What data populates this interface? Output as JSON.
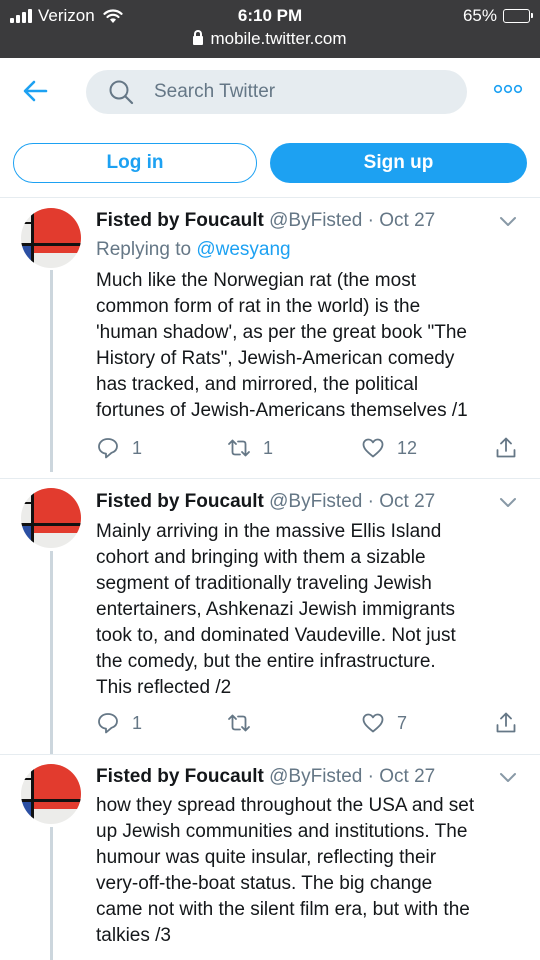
{
  "status_bar": {
    "carrier": "Verizon",
    "time": "6:10 PM",
    "url": "mobile.twitter.com",
    "battery": "65%",
    "battery_level": 0.65,
    "accent": "#ffd60a"
  },
  "header": {
    "back_icon": "back-arrow-icon",
    "search_placeholder": "Search Twitter",
    "more_icon": "more-dots-icon"
  },
  "auth": {
    "login_label": "Log in",
    "signup_label": "Sign up"
  },
  "colors": {
    "brand": "#1da1f2",
    "muted": "#657786"
  },
  "tweets": [
    {
      "name": "Fisted by Foucault",
      "handle": "@ByFisted",
      "date": "· Oct 27",
      "reply_prefix": "Replying to",
      "reply_to": "@wesyang",
      "lines": [
        "Much like the Norwegian rat (the most",
        "common form of rat in the world) is the",
        "'human shadow', as per the great book \"The",
        "History of Rats\", Jewish-American comedy",
        "has tracked, and mirrored, the political",
        "fortunes of Jewish-Americans themselves /1"
      ],
      "replies": "1",
      "retweets": "1",
      "likes": "12"
    },
    {
      "name": "Fisted by Foucault",
      "handle": "@ByFisted",
      "date": "· Oct 27",
      "lines": [
        "Mainly arriving in the massive Ellis Island",
        "cohort and bringing with them a sizable",
        "segment of traditionally traveling Jewish",
        "entertainers, Ashkenazi Jewish immigrants",
        "took to, and dominated Vaudeville.  Not just",
        "the comedy, but the entire infrastructure.",
        "This reflected /2"
      ],
      "replies": "1",
      "retweets": "",
      "likes": "7"
    },
    {
      "name": "Fisted by Foucault",
      "handle": "@ByFisted",
      "date": "· Oct 27",
      "lines": [
        "how they spread throughout the USA and set",
        "up Jewish communities and institutions.  The",
        "humour was quite insular, reflecting their",
        "very-off-the-boat status.  The big change",
        "came not with the silent film era, but with the",
        "talkies /3"
      ]
    }
  ]
}
